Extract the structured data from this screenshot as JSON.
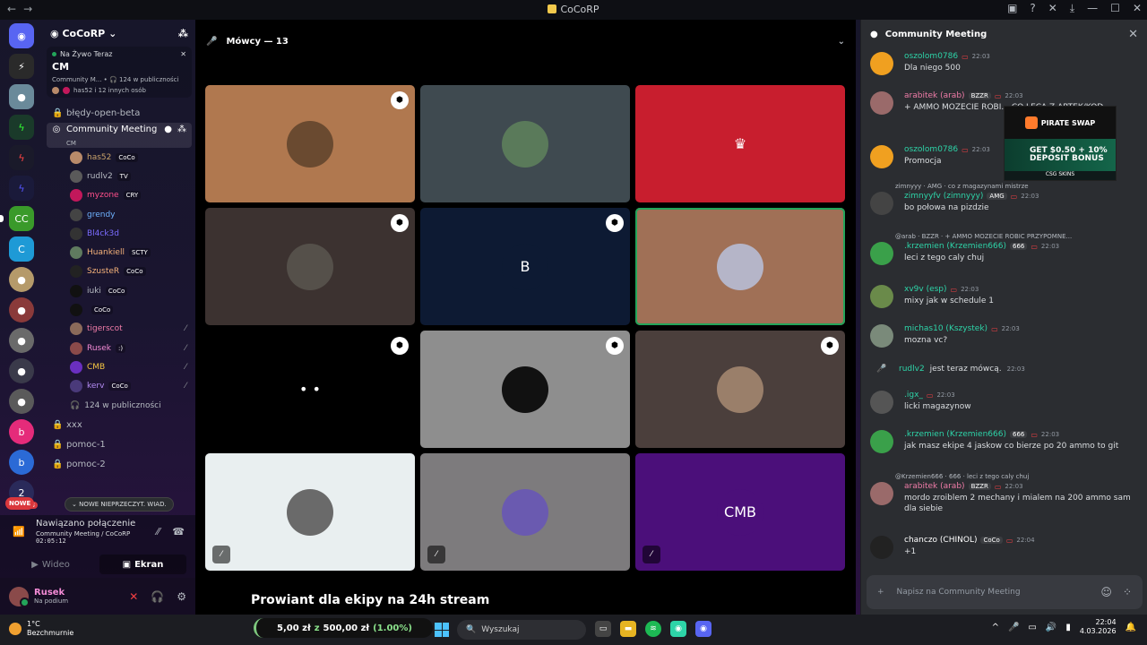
{
  "window": {
    "title": "CoCoRP"
  },
  "server": {
    "name": "CoCoRP"
  },
  "live_now": {
    "tag": "Na Żywo Teraz",
    "title": "CM",
    "sub_channel": "Community M...",
    "sub_audience": "124 w publiczności",
    "sub_people": "has52 i 12 innych osób"
  },
  "channels": {
    "bledy": "błędy-open-beta",
    "community": "Community Meeting",
    "community_sub": "CM",
    "xxx": "xxx",
    "pomoc1": "pomoc-1",
    "pomoc2": "pomoc-2",
    "audience": "124 w publiczności"
  },
  "voice_members": [
    {
      "name": "has52",
      "tag": "CoCo",
      "color": "#c9a36a",
      "av": "#b88a6a",
      "muted": false
    },
    {
      "name": "rudlv2",
      "tag": "TV",
      "color": "#b5bac1",
      "av": "#5a5a5a",
      "muted": false
    },
    {
      "name": "myzone",
      "tag": "CRY",
      "color": "#ff4f8b",
      "av": "#c2185b",
      "muted": false
    },
    {
      "name": "grendy",
      "tag": "",
      "color": "#6fb3ff",
      "av": "#444",
      "muted": false
    },
    {
      "name": "Bl4ck3d",
      "tag": "",
      "color": "#7b6cff",
      "av": "#333",
      "muted": false
    },
    {
      "name": "Huankiell",
      "tag": "SCTY",
      "color": "#f6b27a",
      "av": "#5f7a5f",
      "muted": false
    },
    {
      "name": "SzusteR",
      "tag": "CoCo",
      "color": "#f6b27a",
      "av": "#222",
      "muted": false
    },
    {
      "name": "iuki",
      "tag": "CoCo",
      "color": "#b5bac1",
      "av": "#111",
      "muted": false
    },
    {
      "name": "",
      "tag": "CoCo",
      "color": "#b5bac1",
      "av": "#111",
      "muted": false
    },
    {
      "name": "tigerscot",
      "tag": "",
      "color": "#f07ca8",
      "av": "#8a6a5a",
      "muted": true
    },
    {
      "name": "Rusek",
      "tag": ":)",
      "color": "#f48bd6",
      "av": "#8a4a4a",
      "muted": true
    },
    {
      "name": "CMB",
      "tag": "",
      "color": "#f4c542",
      "av": "#6a2fc0",
      "muted": true
    },
    {
      "name": "kerv",
      "tag": "CoCo",
      "color": "#b58cf5",
      "av": "#4a3a7a",
      "muted": true
    }
  ],
  "new_messages": {
    "badge": "NOWE",
    "label": "NOWE NIEPRZECZYT. WIAD."
  },
  "voice_panel": {
    "status": "Nawiązano połączenie",
    "channel": "Community Meeting / CoCoRP",
    "time": "02:05:12",
    "video_label": "Wideo",
    "screen_label": "Ekran"
  },
  "user": {
    "name": "Rusek",
    "status": "Na podium"
  },
  "stage": {
    "header": "Mówcy — 13",
    "overlay_text": "Prowiant dla ekipy na 24h stream",
    "tiles": [
      {
        "bg": "#b0784f",
        "av": "#6a4a30",
        "label": "",
        "corner": true,
        "mute": false
      },
      {
        "bg": "#3f4a50",
        "av": "#5a7a5a",
        "label": "",
        "corner": false,
        "mute": false
      },
      {
        "bg": "#c81e2e",
        "av": "#c81e2e",
        "label": "♛",
        "corner": false,
        "mute": false
      },
      {
        "bg": "#3c3230",
        "av": "#55504a",
        "label": "",
        "corner": true,
        "mute": false
      },
      {
        "bg": "#0d1a33",
        "av": "#0d1a33",
        "label": "B",
        "corner": true,
        "mute": false
      },
      {
        "bg": "#a07056",
        "av": "#b5b5c8",
        "label": "",
        "corner": false,
        "mute": false
      },
      {
        "bg": "#000000",
        "av": "#000000",
        "label": "• •",
        "corner": true,
        "mute": false
      },
      {
        "bg": "#8e8e8e",
        "av": "#111111",
        "label": "",
        "corner": true,
        "mute": false
      },
      {
        "bg": "#4b3f3c",
        "av": "#9a7f6a",
        "label": "",
        "corner": true,
        "mute": false
      },
      {
        "bg": "#e9eff0",
        "av": "#6a6a6a",
        "label": "",
        "corner": false,
        "mute": true
      },
      {
        "bg": "#7d7b7d",
        "av": "#6a5ab0",
        "label": "",
        "corner": false,
        "mute": true
      },
      {
        "bg": "#4b0f7a",
        "av": "#4b0f7a",
        "label": "CMB",
        "corner": false,
        "mute": true
      }
    ]
  },
  "chat": {
    "title": "Community Meeting",
    "input_placeholder": "Napisz na Community Meeting",
    "messages": [
      {
        "name": "oszolom0786",
        "color": "#2dd4a8",
        "roles": [],
        "time": "22:03",
        "text": "Dla niego 500",
        "av": "#f0a020",
        "reply": ""
      },
      {
        "name": "arabitek (arab)",
        "color": "#f07ca8",
        "roles": [
          "BZZR"
        ],
        "time": "22:03",
        "text": "+ AMMO MOZECIE ROBI... CO LECA Z APTEK/KOD...",
        "av": "#9a6a6a",
        "reply": ""
      },
      {
        "name": "oszolom0786",
        "color": "#2dd4a8",
        "roles": [],
        "time": "22:03",
        "text": "Promocja",
        "av": "#f0a020",
        "reply": ""
      },
      {
        "name": "zimnyyfv (zimnyyy)",
        "color": "#2dd4a8",
        "roles": [
          "AMG"
        ],
        "time": "22:03",
        "text": "bo połowa na pizdzie",
        "av": "#444",
        "reply": "zimnyyy · AMG · co z magazynami mistrze"
      },
      {
        "name": ".krzemien (Krzemien666)",
        "color": "#2dd4a8",
        "roles": [
          "666"
        ],
        "time": "22:03",
        "text": "leci z tego caly chuj",
        "av": "#3aa04a",
        "reply": "@arab · BZZR · + AMMO MOZECIE ROBIC PRZYPOMNE..."
      },
      {
        "name": "xv9v (esp)",
        "color": "#2dd4a8",
        "roles": [],
        "time": "22:03",
        "text": "mixy jak w schedule 1",
        "av": "#6a8a4a",
        "reply": ""
      },
      {
        "name": "michas10 (Kszystek)",
        "color": "#2dd4a8",
        "roles": [],
        "time": "22:03",
        "text": "mozna vc?",
        "av": "#7a8a7a",
        "reply": ""
      },
      {
        "name": ".igx_",
        "color": "#2dd4a8",
        "roles": [],
        "time": "22:03",
        "text": "licki magazynow",
        "av": "#555",
        "reply": ""
      },
      {
        "name": ".krzemien (Krzemien666)",
        "color": "#2dd4a8",
        "roles": [
          "666"
        ],
        "time": "22:03",
        "text": "jak masz ekipe 4 jaskow co bierze po 20 ammo to git",
        "av": "#3aa04a",
        "reply": ""
      },
      {
        "name": "arabitek (arab)",
        "color": "#f07ca8",
        "roles": [
          "BZZR"
        ],
        "time": "22:03",
        "text": "mordo zroiblem 2 mechany i mialem na 200 ammo sam dla siebie",
        "av": "#9a6a6a",
        "reply": "@Krzemien666 · 666 · leci z tego caly chuj"
      },
      {
        "name": "chanczo (CHINOL)",
        "color": "#ffffff",
        "roles": [
          "CoCo"
        ],
        "time": "22:04",
        "text": "+1",
        "av": "#222",
        "reply": ""
      }
    ],
    "system": {
      "name": "rudlv2",
      "text": "jest teraz mówcą.",
      "time": "22:03"
    }
  },
  "ad": {
    "brand": "PIRATE SWAP",
    "offer_line1": "GET $0.50 + 10%",
    "offer_line2": "DEPOSIT BONUS",
    "footer": "CSG SKINS"
  },
  "taskbar": {
    "temp": "1°C",
    "weather": "Bezchmurnie",
    "alert_amount": "5,00 zł",
    "alert_mid": "z",
    "alert_goal": "500,00 zł",
    "alert_pct": "(1.00%)",
    "search": "Wyszukaj",
    "time": "22:04",
    "date": "4.03.2026"
  }
}
